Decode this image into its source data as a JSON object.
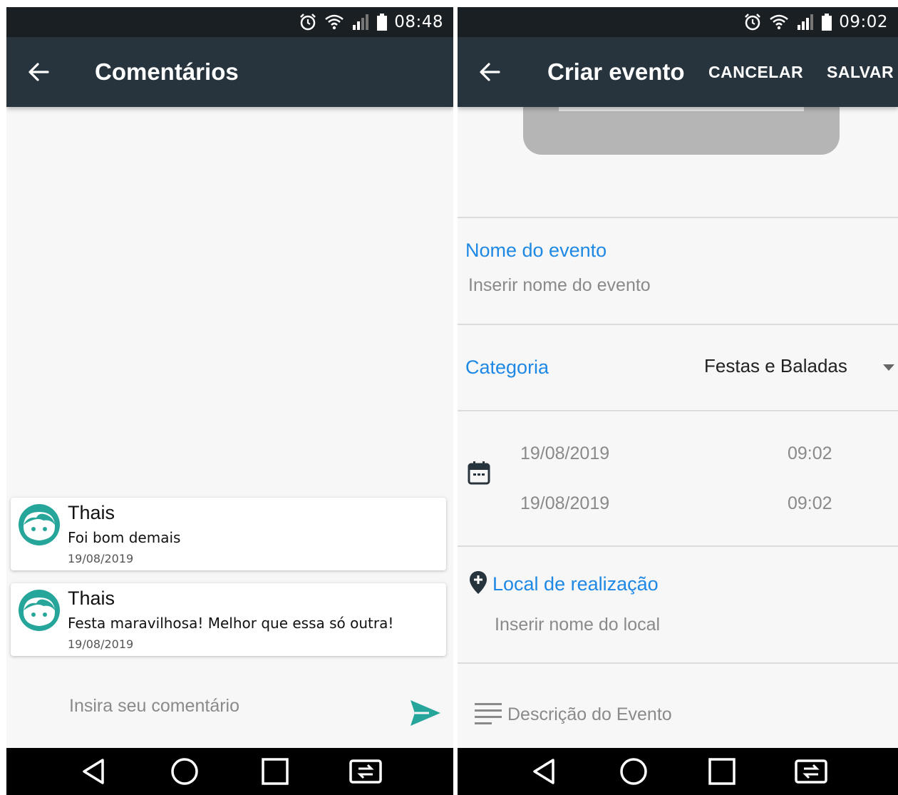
{
  "left": {
    "status": {
      "time": "08:48"
    },
    "appbar": {
      "title": "Comentários"
    },
    "comments": [
      {
        "name": "Thais",
        "text": "Foi bom demais",
        "date": "19/08/2019"
      },
      {
        "name": "Thais",
        "text": "Festa maravilhosa! Melhor que essa só outra!",
        "date": "19/08/2019"
      }
    ],
    "input": {
      "placeholder": "Insira seu comentário"
    }
  },
  "right": {
    "status": {
      "time": "09:02"
    },
    "appbar": {
      "title": "Criar evento",
      "cancel_label": "CANCELAR",
      "save_label": "SALVAR"
    },
    "event_name": {
      "label": "Nome do evento",
      "placeholder": "Inserir nome do evento"
    },
    "category": {
      "label": "Categoria",
      "value": "Festas e Baladas"
    },
    "dates": {
      "start_date": "19/08/2019",
      "start_time": "09:02",
      "end_date": "19/08/2019",
      "end_time": "09:02"
    },
    "location": {
      "label": "Local de realização",
      "placeholder": "Inserir nome do local"
    },
    "description": {
      "placeholder": "Descrição do Evento"
    }
  },
  "colors": {
    "appbar": "#27343d",
    "statusbar": "#1a1f24",
    "accent_blue": "#1e88e5",
    "avatar_teal": "#26a69a",
    "send_teal": "#26a69a"
  },
  "icons": [
    "alarm-icon",
    "wifi-icon",
    "signal-icon",
    "battery-icon",
    "back-arrow-icon",
    "avatar-icon",
    "send-icon",
    "dropdown-arrow-icon",
    "calendar-icon",
    "location-pin-icon",
    "description-lines-icon",
    "nav-back-icon",
    "nav-home-icon",
    "nav-recents-icon",
    "nav-screen-mirror-icon"
  ]
}
